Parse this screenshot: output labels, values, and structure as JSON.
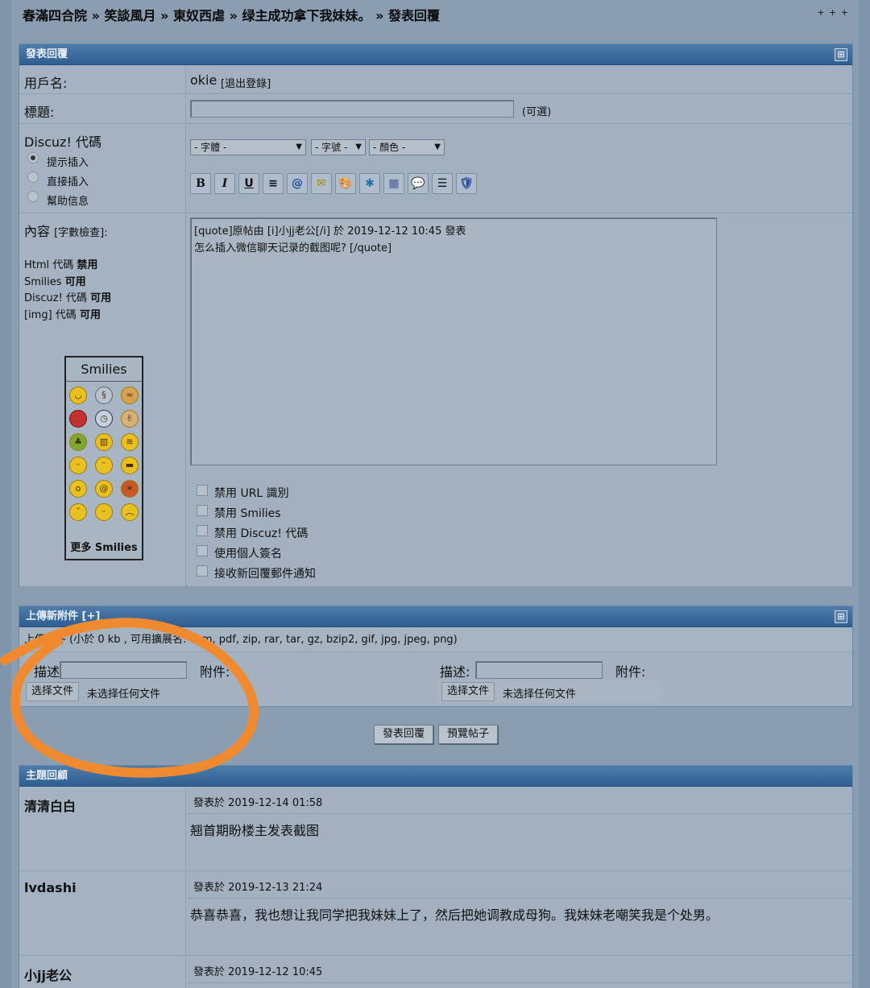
{
  "breadcrumb": {
    "part1": "春滿四合院",
    "sep1": " » ",
    "part2": "笑談風月",
    "sep2": " » ",
    "part3": "東奴西虐",
    "sep3": " » ",
    "part4": "绿主成功拿下我妹妹。",
    "sep4": " » ",
    "part5": "發表回覆",
    "more": "+ + +"
  },
  "reply_panel": {
    "title": "發表回覆",
    "toggle": "⊞",
    "username_label": "用戶名:",
    "username_value": "okie",
    "logout_link": "[退出登錄]",
    "subject_label": "標題:",
    "subject_value": "",
    "subject_optional": "(可選)",
    "discuz_label": "Discuz! 代碼",
    "mode_options": [
      "提示插入",
      "直接插入",
      "幫助信息"
    ],
    "font_select": "- 字體 -",
    "size_select": "- 字號 -",
    "color_select": "- 顏色 -",
    "toolbar_icons": [
      "bold-icon",
      "italic-icon",
      "underline-icon",
      "align-center-icon",
      "url-icon",
      "email-icon",
      "image-icon",
      "flash-icon",
      "code-icon",
      "quote-icon",
      "list-icon",
      "hide-icon"
    ],
    "toolbar_glyphs": [
      "B",
      "I",
      "U",
      "≡",
      "@",
      "✉",
      "🎨",
      "✱",
      "▦",
      "💬",
      "☰",
      "🛡"
    ],
    "content_label": "內容",
    "word_check_link": "[字數檢查]:",
    "html_label": "Html 代碼",
    "html_status": "禁用",
    "smilies_label": "Smilies",
    "smilies_status": "可用",
    "discuz_code_label": "Discuz! 代碼",
    "discuz_code_status": "可用",
    "img_label": "[img] 代碼",
    "img_status": "可用",
    "smilies_title": "Smilies",
    "more_smilies": "更多 Smilies",
    "textarea_line1": "[quote]原帖由 [i]小jj老公[/i] 於 2019-12-12 10:45 發表",
    "textarea_line2": "怎么插入微信聊天记录的截图呢?  [/quote]",
    "options": [
      "禁用 URL 識別",
      "禁用 Smilies",
      "禁用 Discuz! 代碼",
      "使用個人簽名",
      "接收新回覆郵件通知"
    ]
  },
  "attach_panel": {
    "title": "上傳新附件 [+]",
    "toggle": "⊞",
    "info_prefix": "上傳附件",
    "info_text": "(小於 0 kb , 可用擴展名: chm, pdf, zip, rar, tar, gz, bzip2, gif, jpg, jpeg, png)",
    "desc_label": "描述:",
    "attach_label": "附件:",
    "choose_file": "选择文件",
    "no_file": "未选择任何文件"
  },
  "buttons": {
    "submit": "發表回覆",
    "preview": "預覽帖子"
  },
  "thread_panel": {
    "title": "主題回顧",
    "posts": [
      {
        "author": "清清白白",
        "time": "發表於 2019-12-14 01:58",
        "body": "翘首期盼楼主发表截图"
      },
      {
        "author": "lvdashi",
        "time": "發表於 2019-12-13 21:24",
        "body": "恭喜恭喜，我也想让我同学把我妹妹上了，然后把她调教成母狗。我妹妹老嘲笑我是个处男。"
      },
      {
        "author": "小jj老公",
        "time": "發表於 2019-12-12 10:45",
        "body": ""
      }
    ]
  },
  "colors": {
    "panel_header": "#3a6a9c",
    "page_bg": "#8a9db1",
    "annotation": "#f08a30"
  }
}
